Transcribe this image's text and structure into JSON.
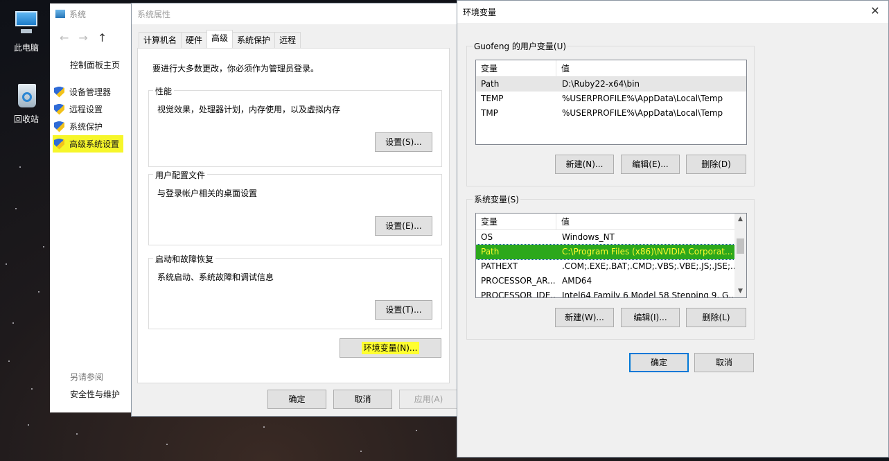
{
  "desktop": {
    "icons": [
      {
        "label": "此电脑",
        "icon": "computer-icon"
      },
      {
        "label": "回收站",
        "icon": "recycle-bin-icon"
      }
    ]
  },
  "system_window": {
    "title": "系统",
    "control_panel_home": "控制面板主页",
    "links": [
      {
        "label": "设备管理器",
        "icon": "shield-icon"
      },
      {
        "label": "远程设置",
        "icon": "shield-icon"
      },
      {
        "label": "系统保护",
        "icon": "shield-icon"
      },
      {
        "label": "高级系统设置",
        "icon": "shield-icon",
        "highlighted": true
      }
    ],
    "see_also": "另请参阅",
    "see_also_link": "安全性与维护"
  },
  "props_dialog": {
    "title": "系统属性",
    "close": "✕",
    "tabs": [
      "计算机名",
      "硬件",
      "高级",
      "系统保护",
      "远程"
    ],
    "active_tab": "高级",
    "admin_note": "要进行大多数更改，你必须作为管理员登录。",
    "performance": {
      "title": "性能",
      "desc": "视觉效果，处理器计划，内存使用，以及虚拟内存",
      "button": "设置(S)..."
    },
    "user_profiles": {
      "title": "用户配置文件",
      "desc": "与登录帐户相关的桌面设置",
      "button": "设置(E)..."
    },
    "startup": {
      "title": "启动和故障恢复",
      "desc": "系统启动、系统故障和调试信息",
      "button": "设置(T)..."
    },
    "env_button": "环境变量(N)...",
    "ok": "确定",
    "cancel": "取消",
    "apply": "应用(A)"
  },
  "env_dialog": {
    "title": "环境变量",
    "close": "✕",
    "user_vars": {
      "title": "Guofeng 的用户变量(U)",
      "columns": [
        "变量",
        "值"
      ],
      "rows": [
        {
          "name": "Path",
          "value": "D:\\Ruby22-x64\\bin"
        },
        {
          "name": "TEMP",
          "value": "%USERPROFILE%\\AppData\\Local\\Temp"
        },
        {
          "name": "TMP",
          "value": "%USERPROFILE%\\AppData\\Local\\Temp"
        }
      ],
      "new": "新建(N)...",
      "edit": "编辑(E)...",
      "delete": "删除(D)"
    },
    "system_vars": {
      "title": "系统变量(S)",
      "columns": [
        "变量",
        "值"
      ],
      "rows": [
        {
          "name": "OS",
          "value": "Windows_NT"
        },
        {
          "name": "Path",
          "value": "C:\\Program Files (x86)\\NVIDIA Corporat..."
        },
        {
          "name": "PATHEXT",
          "value": ".COM;.EXE;.BAT;.CMD;.VBS;.VBE;.JS;.JSE;..."
        },
        {
          "name": "PROCESSOR_AR...",
          "value": "AMD64"
        },
        {
          "name": "PROCESSOR_IDE...",
          "value": "Intel64 Family 6 Model 58 Stepping 9, G..."
        }
      ],
      "new": "新建(W)...",
      "edit": "编辑(I)...",
      "delete": "删除(L)"
    },
    "ok": "确定",
    "cancel": "取消"
  },
  "colors": {
    "highlight_yellow": "#f6f62a",
    "selection_green": "#2ca81b",
    "accent_blue": "#0078d7"
  }
}
